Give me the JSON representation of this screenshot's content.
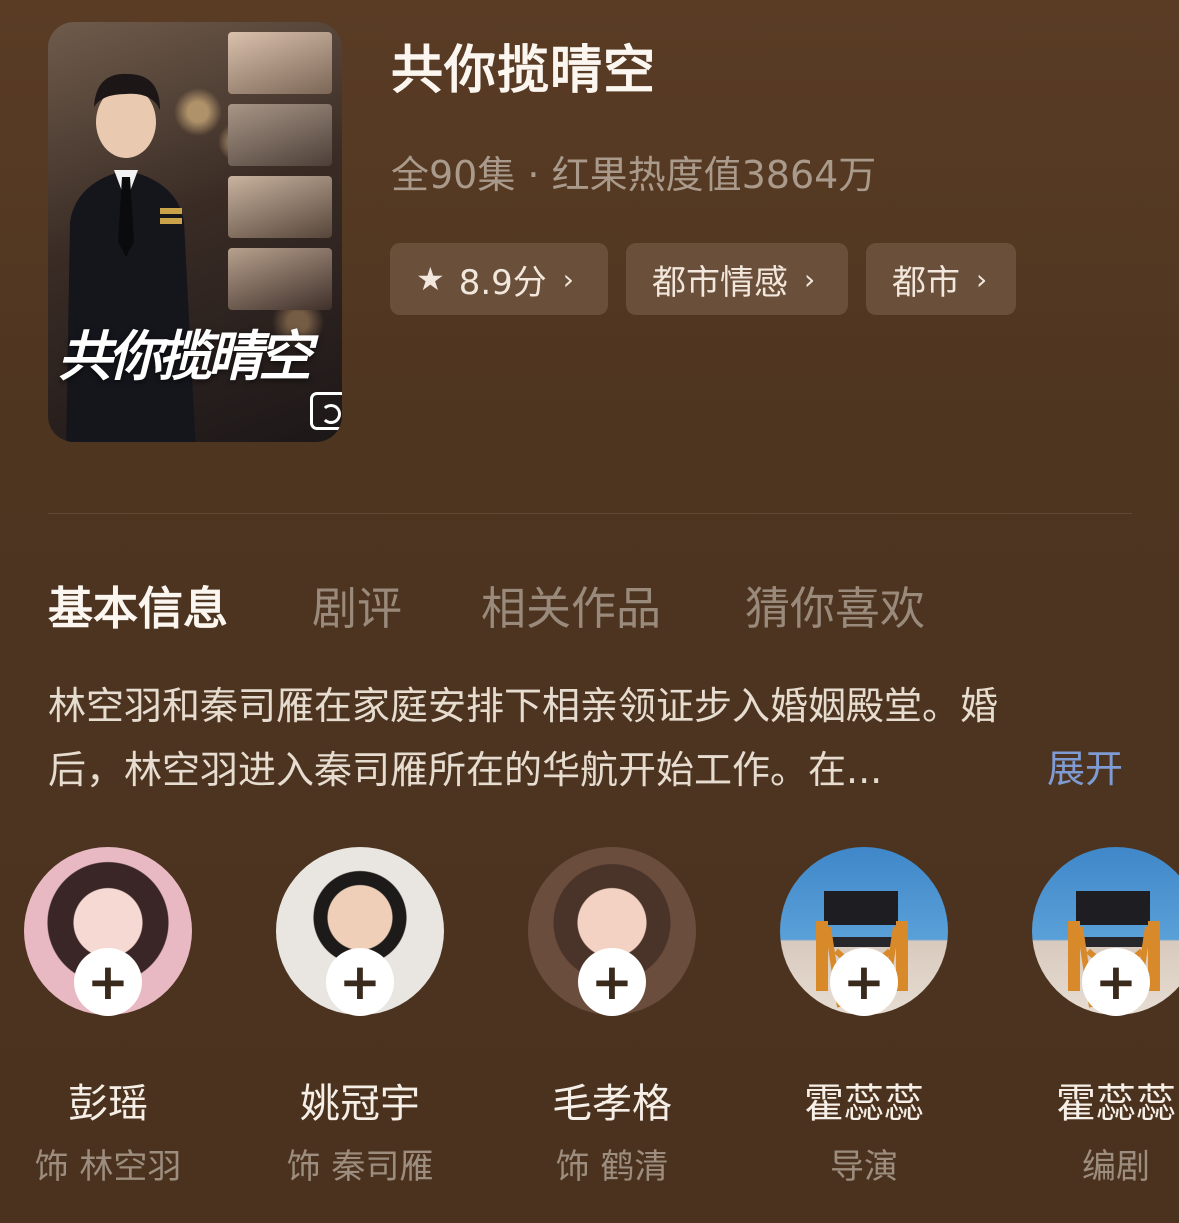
{
  "poster": {
    "title_art": "共你揽晴空"
  },
  "drama": {
    "title": "共你揽晴空",
    "meta": "全90集 · 红果热度值3864万"
  },
  "tags": [
    {
      "label": "8.9分",
      "icon": "star-icon"
    },
    {
      "label": "都市情感"
    },
    {
      "label": "都市"
    }
  ],
  "tabs": [
    {
      "label": "基本信息",
      "active": true
    },
    {
      "label": "剧评"
    },
    {
      "label": "相关作品"
    },
    {
      "label": "猜你喜欢"
    }
  ],
  "synopsis": {
    "line1": "林空羽和秦司雁在家庭安排下相亲领证步入婚姻殿堂。婚",
    "line2": "后，林空羽进入秦司雁所在的华航开始工作。在...",
    "expand_label": "展开"
  },
  "cast": [
    {
      "name": "彭瑶",
      "role": "饰 林空羽"
    },
    {
      "name": "姚冠宇",
      "role": "饰 秦司雁"
    },
    {
      "name": "毛孝格",
      "role": "饰 鹤清"
    },
    {
      "name": "霍蕊蕊",
      "role": "导演"
    },
    {
      "name": "霍蕊蕊",
      "role": "编剧"
    }
  ],
  "colors": {
    "background": "#4e3520",
    "chip": "#6a4f3a",
    "accent_link": "#7f9bd3"
  }
}
